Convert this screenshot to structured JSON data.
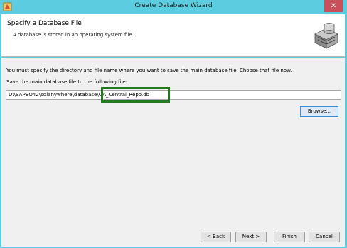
{
  "window": {
    "title": "Create Database Wizard",
    "close_glyph": "✕"
  },
  "header": {
    "title": "Specify a Database File",
    "subtitle": "A database is stored in an operating system file.",
    "icon": "database-icon"
  },
  "main": {
    "instructions": "You must specify the directory and file name where you want to save the main database file. Choose that file now.",
    "field_label": "Save the main database file to the following file:",
    "file_path_value": "D:\\SAPBO42\\sqlanywhere\\database\\QA_Central_Repo.db",
    "browse_label": "Browse..."
  },
  "footer": {
    "back_label": "< Back",
    "next_label": "Next >",
    "finish_label": "Finish",
    "cancel_label": "Cancel"
  },
  "colors": {
    "titlebar": "#5ccde0",
    "close_button": "#c7505a",
    "highlight_box": "#237a20",
    "panel_background": "#f0f0f0"
  }
}
